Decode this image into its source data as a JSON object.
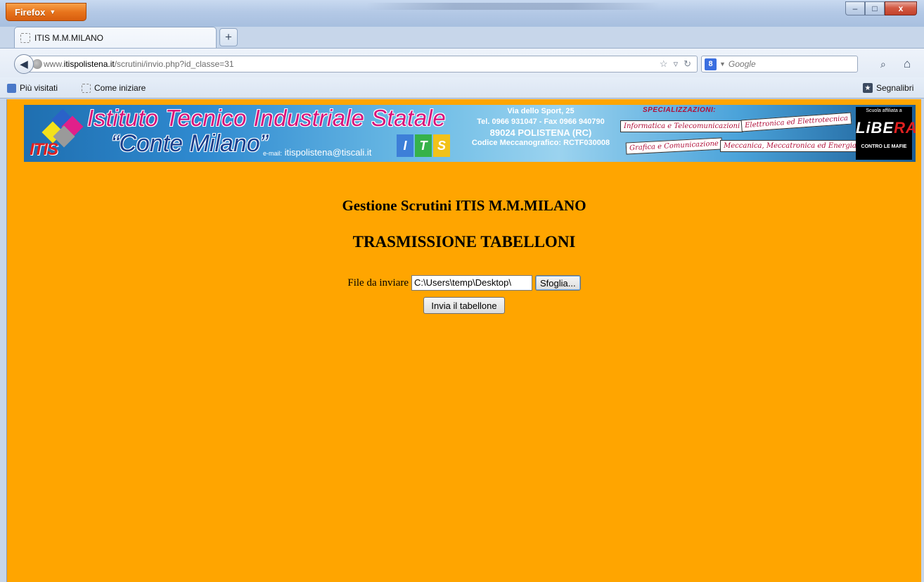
{
  "browser": {
    "menu_button_label": "Firefox",
    "window_controls": {
      "minimize": "–",
      "maximize": "□",
      "close": "x"
    },
    "tab": {
      "title": "ITIS M.M.MILANO"
    },
    "new_tab_label": "+",
    "url": {
      "prefix": "www.",
      "domain": "itispolistena.it",
      "path": "/scrutini/invio.php?id_classe=31"
    },
    "search": {
      "engine_letter": "8",
      "placeholder": "Google"
    },
    "bookmarks": {
      "most_visited": "Più visitati",
      "getting_started": "Come iniziare",
      "bookmarks_menu": "Segnalibri"
    }
  },
  "banner": {
    "title": "Istituto Tecnico Industriale Statale",
    "subtitle": "“Conte Milano”",
    "logo_text": "ITIS",
    "email_label": "e-mail:",
    "email": "itispolistena@tiscali.it",
    "its_letters": [
      "I",
      "T",
      "S"
    ],
    "address_line1": "Via dello Sport, 25",
    "address_line2": "Tel. 0966 931047 - Fax 0966 940790",
    "address_line3": "89024 POLISTENA (RC)",
    "address_line4": "Codice Meccanografico: RCTF030008",
    "specializations_label": "SPECIALIZZAZIONI:",
    "specializations": [
      "Informatica e Telecomunicazioni",
      "Elettronica ed Elettrotecnica",
      "Grafica e Comunicazione",
      "Meccanica, Meccatronica ed Energia"
    ],
    "libera": {
      "top": "Scuola affiliata a",
      "word_start": "LiBE",
      "word_end": "RA",
      "bottom": "CONTRO LE MAFIE"
    }
  },
  "main": {
    "title": "Gestione Scrutini ITIS M.M.MILANO",
    "subtitle": "TRASMISSIONE TABELLONI",
    "file_label": "File da inviare",
    "file_value": "C:\\Users\\temp\\Desktop\\",
    "browse_label": "Sfoglia...",
    "submit_label": "Invia il tabellone"
  },
  "colors": {
    "page_background": "#ffa500",
    "firefox_button": "#e8741c",
    "banner_blue": "#2f8ad0"
  }
}
